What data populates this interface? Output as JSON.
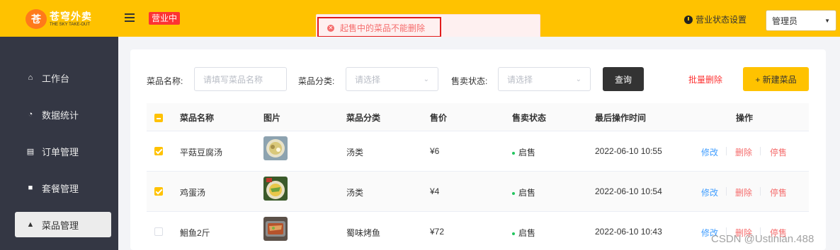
{
  "header": {
    "logo_title": "苍穹外卖",
    "logo_subtitle": "THE SKY TAKE-OUT",
    "status_tag": "营业中",
    "store_status_label": "营业状态设置",
    "user_select": "管理员"
  },
  "toast": {
    "message": "起售中的菜品不能删除"
  },
  "sidebar": {
    "items": [
      {
        "label": "工作台",
        "icon": "home-icon"
      },
      {
        "label": "数据统计",
        "icon": "chart-icon"
      },
      {
        "label": "订单管理",
        "icon": "clipboard-icon"
      },
      {
        "label": "套餐管理",
        "icon": "gift-icon"
      },
      {
        "label": "菜品管理",
        "icon": "dish-icon"
      }
    ]
  },
  "filters": {
    "name_label": "菜品名称:",
    "name_placeholder": "请填写菜品名称",
    "category_label": "菜品分类:",
    "category_placeholder": "请选择",
    "status_label": "售卖状态:",
    "status_placeholder": "请选择",
    "query_button": "查询",
    "batch_delete": "批量删除",
    "new_button": "+ 新建菜品"
  },
  "table": {
    "headers": [
      "菜品名称",
      "图片",
      "菜品分类",
      "售价",
      "售卖状态",
      "最后操作时间",
      "操作"
    ],
    "rows": [
      {
        "checked": true,
        "name": "平菇豆腐汤",
        "category": "汤类",
        "price": "¥6",
        "status": "启售",
        "time": "2022-06-10 10:55",
        "edit": "修改",
        "delete": "删除",
        "stop": "停售"
      },
      {
        "checked": true,
        "name": "鸡蛋汤",
        "category": "汤类",
        "price": "¥4",
        "status": "启售",
        "time": "2022-06-10 10:54",
        "edit": "修改",
        "delete": "删除",
        "stop": "停售"
      },
      {
        "checked": false,
        "name": "鮰鱼2斤",
        "category": "蜀味烤鱼",
        "price": "¥72",
        "status": "启售",
        "time": "2022-06-10 10:43",
        "edit": "修改",
        "delete": "删除",
        "stop": "停售"
      }
    ]
  },
  "watermark": "CSDN @Ustinian.488",
  "colors": {
    "brand": "#ffc200",
    "sidebar": "#343744",
    "danger": "#fd3333",
    "link": "#419eff"
  }
}
